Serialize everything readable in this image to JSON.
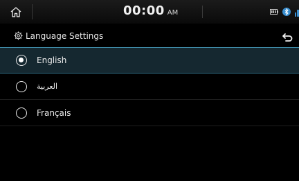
{
  "status_bar": {
    "time": "00:00",
    "ampm": "AM"
  },
  "header": {
    "title": "Language Settings"
  },
  "languages": [
    {
      "label": "English",
      "selected": true
    },
    {
      "label": "العربية",
      "selected": false
    },
    {
      "label": "Français",
      "selected": false
    }
  ],
  "icons": {
    "home": "home-icon",
    "settings": "gear-icon",
    "back": "back-arrow-icon",
    "battery": "battery-icon",
    "connectivity": "bluetooth-phone-icon",
    "signal": "signal-icon"
  },
  "colors": {
    "selected_row_bg": "#152830",
    "selected_row_border": "#3e8aa6",
    "background": "#000000"
  }
}
